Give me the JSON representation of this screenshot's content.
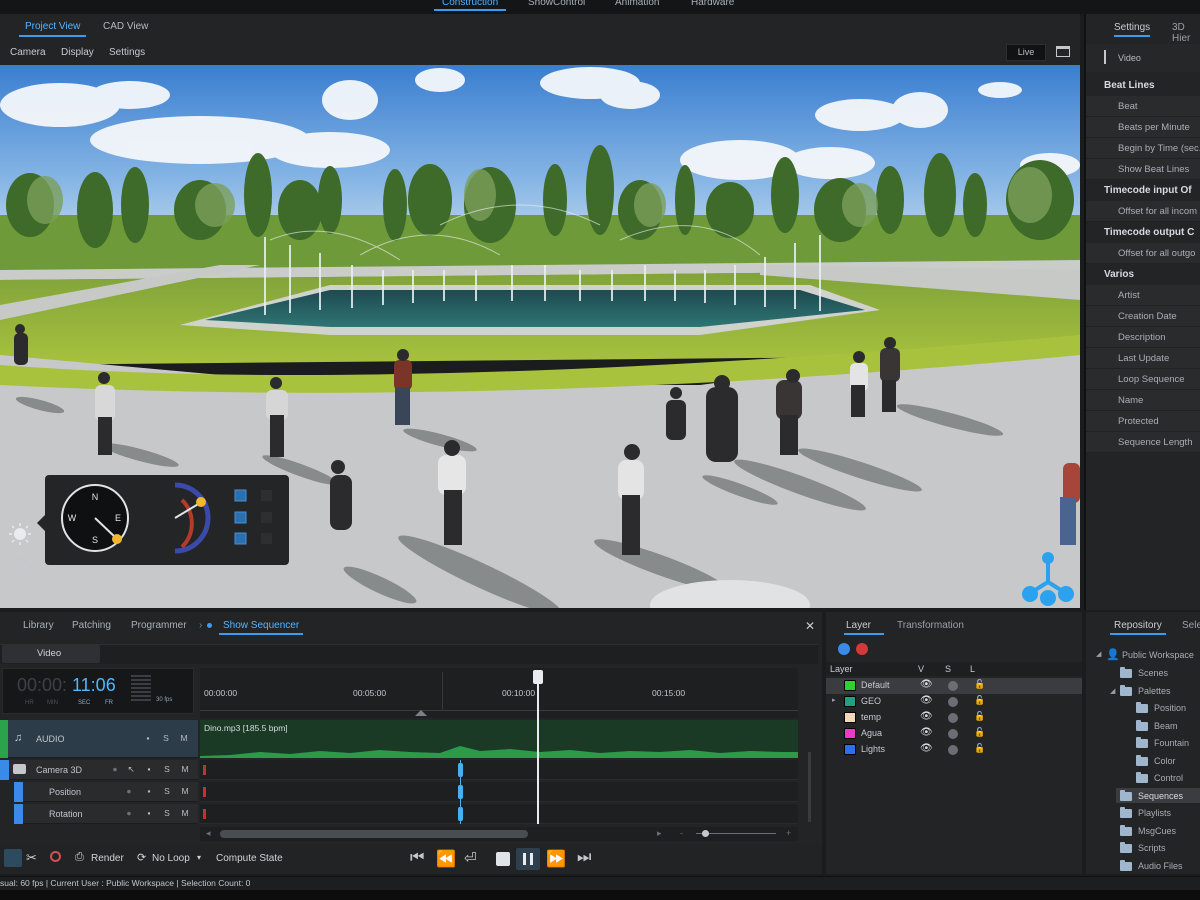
{
  "top_menu": [
    "Construction",
    "ShowControl",
    "Animation",
    "Hardware"
  ],
  "project_tabs": [
    "Project View",
    "CAD View"
  ],
  "project_subbar": [
    "Camera",
    "Display",
    "Settings"
  ],
  "live_label": "Live",
  "compass": {
    "n": "N",
    "e": "E",
    "s": "S",
    "w": "W"
  },
  "settings": {
    "tabs": [
      "Settings",
      "3D Hier"
    ],
    "video_label": "Video",
    "sections": [
      {
        "title": "Beat Lines",
        "rows": [
          "Beat",
          "Beats per Minute",
          "Begin by Time (sec.",
          "Show Beat Lines"
        ]
      },
      {
        "title": "Timecode input Of",
        "rows": [
          "Offset for all incom"
        ]
      },
      {
        "title": "Timecode output C",
        "rows": [
          "Offset for all outgo"
        ]
      },
      {
        "title": "Varios",
        "rows": [
          "Artist",
          "Creation Date",
          "Description",
          "Last Update",
          "Loop Sequence",
          "Name",
          "Protected",
          "Sequence Length"
        ]
      }
    ]
  },
  "bottom_tabs": [
    "Library",
    "Patching",
    "Programmer",
    "Show Sequencer"
  ],
  "video_tab": "Video",
  "timecode": {
    "dim": "00:00:",
    "bright": "11:06",
    "units": [
      "HR",
      "MIN",
      "SEC",
      "FR"
    ],
    "fps": "30 fps"
  },
  "ruler_labels": [
    "00:00:00",
    "00:05:00",
    "00:10:00",
    "00:15:00"
  ],
  "audio_clip_label": "Dino.mp3  [185.5 bpm]",
  "tracks": [
    {
      "label": "AUDIO",
      "lock": "🔒",
      "s": "S",
      "m": "M"
    },
    {
      "label": "Camera 3D",
      "lock": "🔒",
      "s": "S",
      "m": "M"
    },
    {
      "label": "Position",
      "lock": "🔒",
      "s": "S",
      "m": "M"
    },
    {
      "label": "Rotation",
      "lock": "🔒",
      "s": "S",
      "m": "M"
    }
  ],
  "bottom_toolbar": {
    "render": "Render",
    "loop": "No Loop",
    "compute": "Compute State"
  },
  "layer_panel": {
    "tabs": [
      "Layer",
      "Transformation"
    ],
    "headers": [
      "Layer",
      "V",
      "S",
      "L"
    ],
    "layers": [
      {
        "name": "Default",
        "color": "#2fd12f"
      },
      {
        "name": "GEO",
        "color": "#1fa080"
      },
      {
        "name": "temp",
        "color": "#f0d8b8"
      },
      {
        "name": "Agua",
        "color": "#f038c8"
      },
      {
        "name": "Lights",
        "color": "#2a6ff0"
      }
    ]
  },
  "repository": {
    "tabs": [
      "Repository",
      "Sele"
    ],
    "items": [
      "Public Workspace",
      "Scenes",
      "Palettes",
      "Position",
      "Beam",
      "Fountain",
      "Color",
      "Control",
      "Sequences",
      "Playlists",
      "MsgCues",
      "Scripts",
      "Audio Files"
    ]
  },
  "status": "sual: 60 fps  |  Current User :  Public Workspace  |  Selection Count:  0",
  "colors": {
    "accent": "#3a9bef",
    "panel": "#232426",
    "audio_wave": "#2b9a4a"
  }
}
